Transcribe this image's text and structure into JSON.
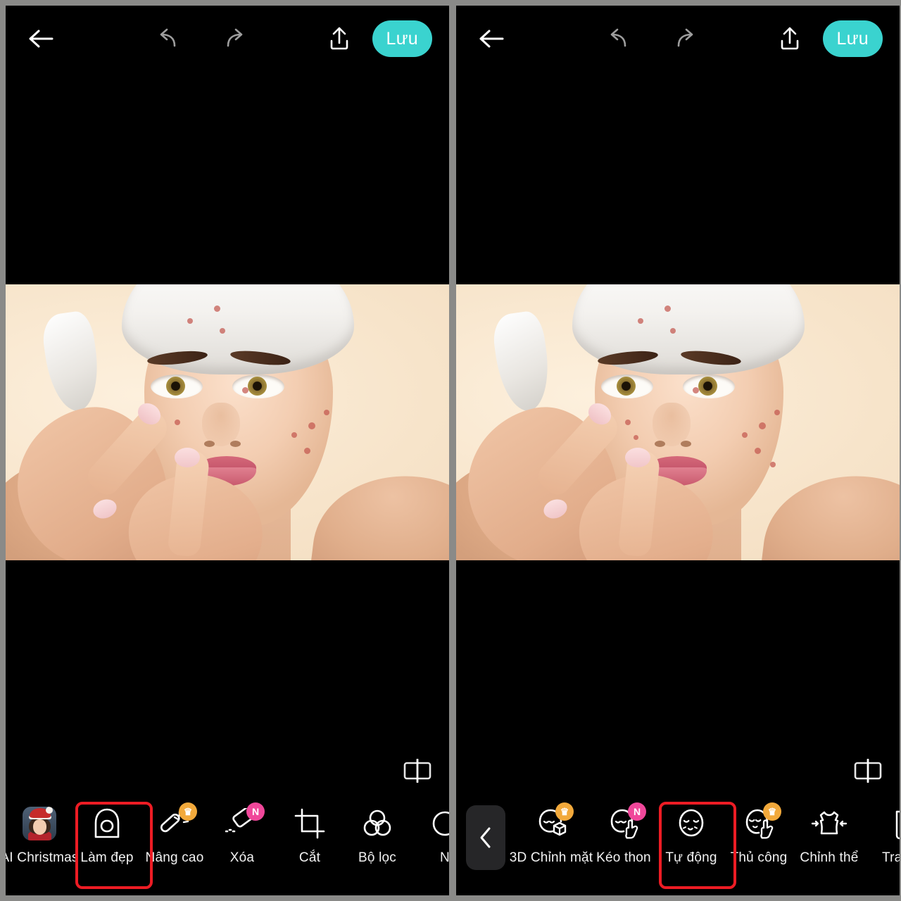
{
  "app": {
    "accent_teal": "#3AD3CF",
    "highlight_red": "#ED1C24",
    "badge_crown_color": "#F2A93B",
    "badge_new_color": "#F0479A",
    "background": "#000000",
    "frame_gray": "#8a8a88"
  },
  "panels": [
    {
      "id": "left-panel",
      "topbar": {
        "back_label": "back-arrow",
        "undo_label": "undo",
        "redo_label": "redo",
        "share_label": "share",
        "save_label": "Lưu"
      },
      "compare_icon": "before-after-compare",
      "toolbar": {
        "items": [
          {
            "label": "AI Christmas",
            "icon": "ai-christmas-thumbnail",
            "badge": "",
            "selected": false
          },
          {
            "label": "Làm đẹp",
            "icon": "beautify-face-icon",
            "badge": "",
            "selected": true
          },
          {
            "label": "Nâng cao",
            "icon": "magic-wand-icon",
            "badge": "crown",
            "selected": false
          },
          {
            "label": "Xóa",
            "icon": "eraser-icon",
            "badge": "N",
            "selected": false
          },
          {
            "label": "Cắt",
            "icon": "crop-icon",
            "badge": "",
            "selected": false
          },
          {
            "label": "Bộ lọc",
            "icon": "filters-three-circles-icon",
            "badge": "",
            "selected": false
          },
          {
            "label": "N",
            "icon": "partial-icon",
            "badge": "",
            "selected": false
          }
        ]
      }
    },
    {
      "id": "right-panel",
      "topbar": {
        "back_label": "back-arrow",
        "undo_label": "undo",
        "redo_label": "redo",
        "share_label": "share",
        "save_label": "Lưu"
      },
      "compare_icon": "before-after-compare",
      "toolbar": {
        "back_chip": "chevron-left",
        "items": [
          {
            "label": "3D Chỉnh mặt",
            "icon": "face-3d-cube-icon",
            "badge": "crown",
            "selected": false
          },
          {
            "label": "Kéo thon",
            "icon": "face-reshape-hand-icon",
            "badge": "N",
            "selected": false
          },
          {
            "label": "Tự động",
            "icon": "face-auto-icon",
            "badge": "",
            "selected": true
          },
          {
            "label": "Thủ công",
            "icon": "face-manual-hand-icon",
            "badge": "crown",
            "selected": false
          },
          {
            "label": "Chỉnh thể",
            "icon": "body-reshape-icon",
            "badge": "",
            "selected": false
          },
          {
            "label": "Trang",
            "icon": "makeup-icon",
            "badge": "",
            "selected": false
          }
        ]
      }
    }
  ],
  "photo": {
    "description": "Young woman with white towel on head touching acne on her cheek",
    "acne_spots_left_image": 9,
    "acne_spots_right_image": 11
  }
}
